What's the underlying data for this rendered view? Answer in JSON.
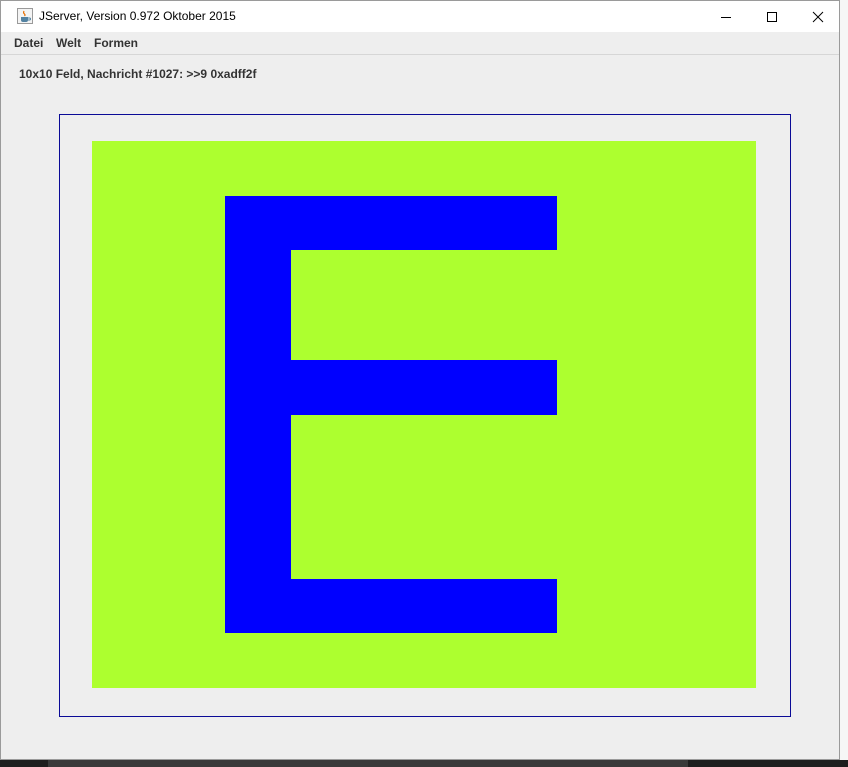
{
  "window": {
    "title": "JServer, Version 0.972 Oktober 2015",
    "app_icon": "java-cup-icon",
    "controls": {
      "minimize_icon": "minimize-icon",
      "maximize_icon": "maximize-icon",
      "close_icon": "close-icon"
    }
  },
  "menu": {
    "items": [
      {
        "label": "Datei"
      },
      {
        "label": "Welt"
      },
      {
        "label": "Formen"
      }
    ]
  },
  "status": {
    "text": "10x10 Feld, Nachricht #1027: >>9 0xadff2f"
  },
  "board": {
    "background_color": "#adff2f",
    "shape_color": "#0000ff",
    "frame_color": "#0a0a96",
    "shape": "letter E"
  },
  "colors": {
    "window_bg": "#eeeeee",
    "titlebar_bg": "#ffffff"
  }
}
